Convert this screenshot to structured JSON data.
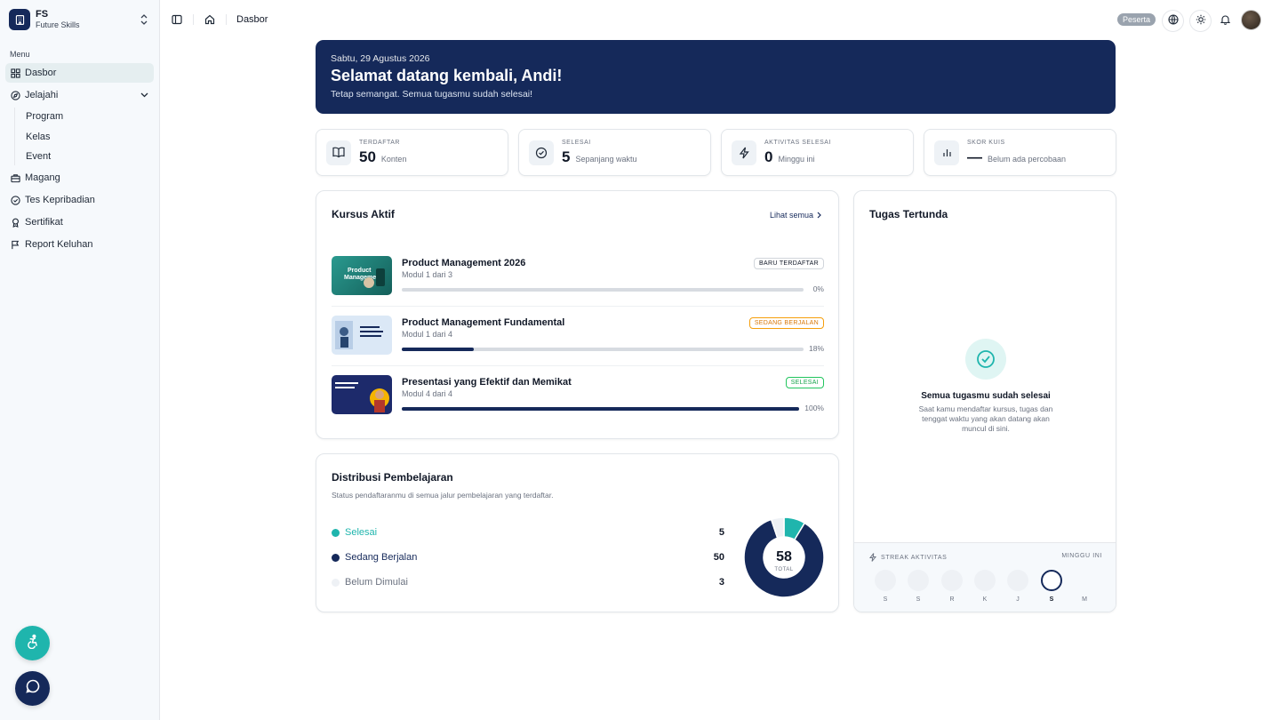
{
  "brand": {
    "short": "FS",
    "name": "Future Skills"
  },
  "sidebar": {
    "menu_label": "Menu",
    "items": [
      {
        "label": "Dasbor",
        "icon": "dashboard-icon",
        "active": true
      },
      {
        "label": "Jelajahi",
        "icon": "compass-icon",
        "expanded": true,
        "children": [
          {
            "label": "Program"
          },
          {
            "label": "Kelas"
          },
          {
            "label": "Event"
          }
        ]
      },
      {
        "label": "Magang",
        "icon": "briefcase-icon"
      },
      {
        "label": "Tes Kepribadian",
        "icon": "check-circle-icon"
      },
      {
        "label": "Sertifikat",
        "icon": "award-icon"
      },
      {
        "label": "Report Keluhan",
        "icon": "flag-icon"
      }
    ]
  },
  "topbar": {
    "breadcrumb": "Dasbor",
    "role": "Peserta"
  },
  "hero": {
    "date": "Sabtu, 29 Agustus 2026",
    "title": "Selamat datang kembali, Andi!",
    "subtitle": "Tetap semangat. Semua tugasmu sudah selesai!"
  },
  "stats": [
    {
      "label": "TERDAFTAR",
      "value": "50",
      "note": "Konten",
      "icon": "book-icon"
    },
    {
      "label": "SELESAI",
      "value": "5",
      "note": "Sepanjang waktu",
      "icon": "check-circle-icon"
    },
    {
      "label": "AKTIVITAS SELESAI",
      "value": "0",
      "note": "Minggu ini",
      "icon": "bolt-icon"
    },
    {
      "label": "SKOR KUIS",
      "value": "—",
      "note": "Belum ada percobaan",
      "icon": "bar-chart-icon"
    }
  ],
  "courses": {
    "title": "Kursus Aktif",
    "see_all": "Lihat semua",
    "items": [
      {
        "name": "Product Management 2026",
        "module": "Modul 1 dari 3",
        "badge": "BARU TERDAFTAR",
        "badge_type": "new",
        "progress": 0,
        "progress_label": "0%",
        "thumb_color": "#1f7a74"
      },
      {
        "name": "Product Management Fundamental",
        "module": "Modul 1 dari 4",
        "badge": "SEDANG BERJALAN",
        "badge_type": "run",
        "progress": 18,
        "progress_label": "18%",
        "thumb_color": "#d9e8f5"
      },
      {
        "name": "Presentasi yang Efektif dan Memikat",
        "module": "Modul 4 dari 4",
        "badge": "SELESAI",
        "badge_type": "done",
        "progress": 100,
        "progress_label": "100%",
        "thumb_color": "#1d2a6b"
      }
    ]
  },
  "distribution": {
    "title": "Distribusi Pembelajaran",
    "description": "Status pendaftaranmu di semua jalur pembelajaran yang terdaftar.",
    "items": [
      {
        "label": "Selesai",
        "value": 5,
        "color": "#1fb5ad"
      },
      {
        "label": "Sedang Berjalan",
        "value": 50,
        "color": "#15295a"
      },
      {
        "label": "Belum Dimulai",
        "value": 3,
        "color": "#eef1f5"
      }
    ],
    "total": "58",
    "total_label": "TOTAL"
  },
  "tasks": {
    "title": "Tugas Tertunda",
    "empty_title": "Semua tugasmu sudah selesai",
    "empty_text": "Saat kamu mendaftar kursus, tugas dan tenggat waktu yang akan datang akan muncul di sini."
  },
  "streak": {
    "label": "STREAK AKTIVITAS",
    "period": "MINGGU INI",
    "days": [
      {
        "label": "S",
        "state": "past"
      },
      {
        "label": "S",
        "state": "past"
      },
      {
        "label": "R",
        "state": "past"
      },
      {
        "label": "K",
        "state": "past"
      },
      {
        "label": "J",
        "state": "past"
      },
      {
        "label": "S",
        "state": "today"
      },
      {
        "label": "M",
        "state": "future"
      }
    ]
  },
  "colors": {
    "primary": "#15295a",
    "accent": "#1fb5ad",
    "warning": "#f59e0b",
    "success": "#22c55e"
  }
}
